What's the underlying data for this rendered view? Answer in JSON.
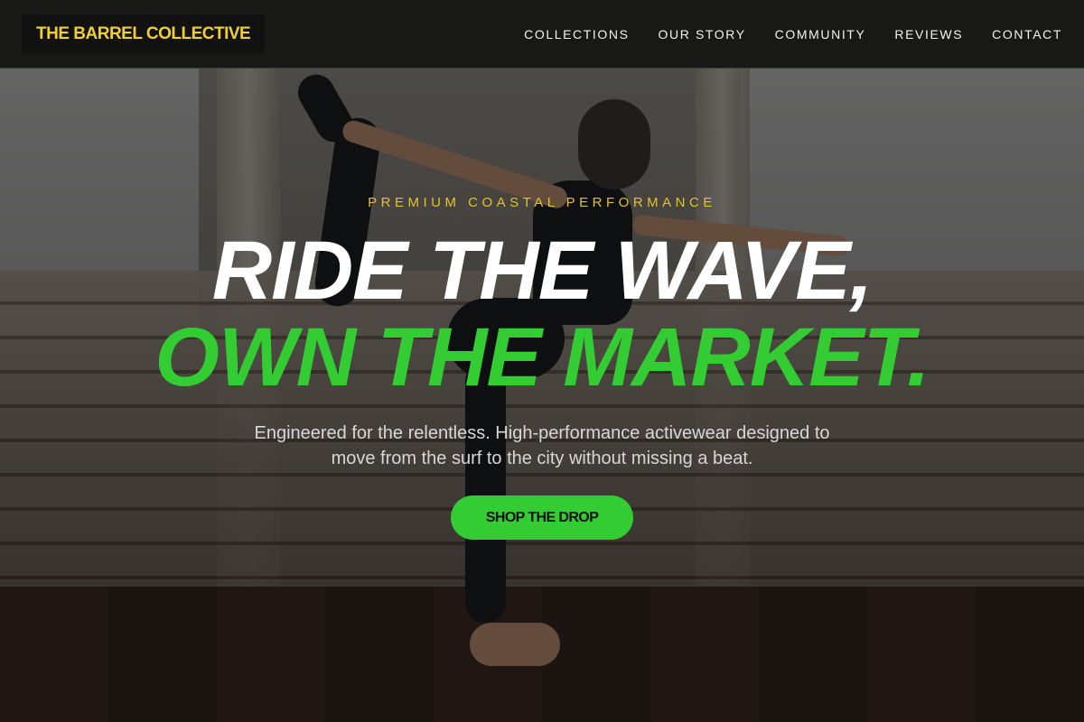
{
  "brand": {
    "logo_text": "THE BARREL COLLECTIVE",
    "accent": "#f2cf2c",
    "green": "#33cc33"
  },
  "nav": {
    "items": [
      {
        "label": "COLLECTIONS"
      },
      {
        "label": "OUR STORY"
      },
      {
        "label": "COMMUNITY"
      },
      {
        "label": "REVIEWS"
      },
      {
        "label": "CONTACT"
      }
    ]
  },
  "hero": {
    "eyebrow": "PREMIUM COASTAL PERFORMANCE",
    "headline_line1": "RIDE THE WAVE,",
    "headline_line2": "OWN THE MARKET.",
    "subheadline": "Engineered for the relentless. High-performance activewear designed to move from the surf to the city without missing a beat.",
    "cta_label": "SHOP THE DROP"
  }
}
